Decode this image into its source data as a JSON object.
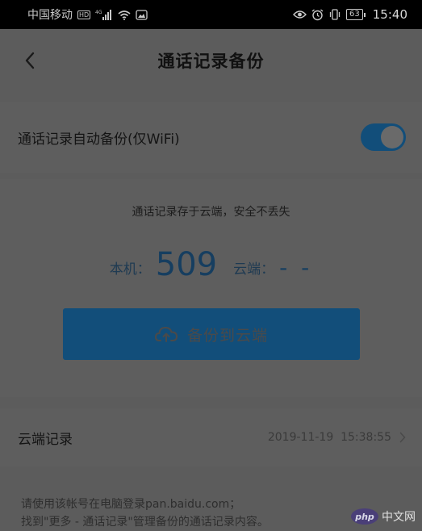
{
  "status_bar": {
    "carrier": "中国移动",
    "hd_badge": "HD",
    "network": "4G",
    "battery": "63",
    "time": "15:40",
    "icons": [
      "signal-icon",
      "wifi-icon",
      "image-notification-icon",
      "eye-icon",
      "alarm-icon",
      "vibrate-icon",
      "battery-icon"
    ]
  },
  "header": {
    "title": "通话记录备份",
    "back_icon": "chevron-left-icon"
  },
  "auto_backup": {
    "label": "通话记录自动备份(仅WiFi)",
    "enabled": true
  },
  "summary": {
    "subtitle": "通话记录存于云端，安全不丢失",
    "local_label": "本机：",
    "local_count": "509",
    "cloud_label": "云端：",
    "cloud_count": "- -"
  },
  "backup_button": {
    "label": "备份到云端",
    "icon": "cloud-upload-icon"
  },
  "cloud_records": {
    "label": "云端记录",
    "timestamp": "2019-11-19  15:38:55",
    "icon": "chevron-right-icon"
  },
  "note": {
    "line1": "请使用该帐号在电脑登录pan.baidu.com；",
    "line2": "找到\"更多 - 通话记录\"管理备份的通话记录内容。"
  },
  "watermark": {
    "logo": "php",
    "text": "中文网"
  },
  "colors": {
    "accent": "#124e7a",
    "overlay_background": "#5c5c5c"
  }
}
